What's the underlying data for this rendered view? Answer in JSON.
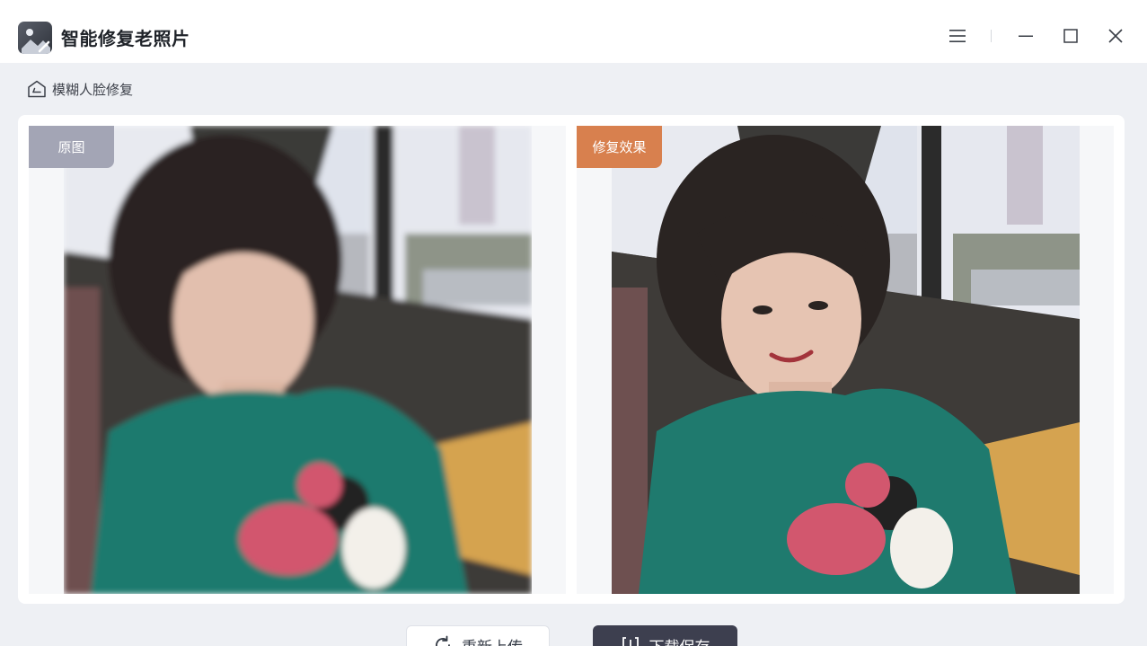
{
  "app": {
    "title": "智能修复老照片",
    "logo_icon": "photo-repair-icon"
  },
  "window_controls": {
    "menu_icon": "hamburger-menu-icon",
    "minimize_icon": "minimize-icon",
    "maximize_icon": "maximize-icon",
    "close_icon": "close-icon"
  },
  "breadcrumb": {
    "icon": "home-icon",
    "label": "模糊人脸修复"
  },
  "compare": {
    "original_label": "原图",
    "result_label": "修复效果",
    "original_tag_color": "#a3a5b5",
    "result_tag_color": "#d8804e"
  },
  "actions": {
    "reupload_label": "重新上传",
    "reupload_icon": "refresh-icon",
    "download_label": "下载保存",
    "download_icon": "save-bracket-icon"
  },
  "colors": {
    "primary_button": "#3d3f4f",
    "accent_orange": "#d8804e"
  }
}
